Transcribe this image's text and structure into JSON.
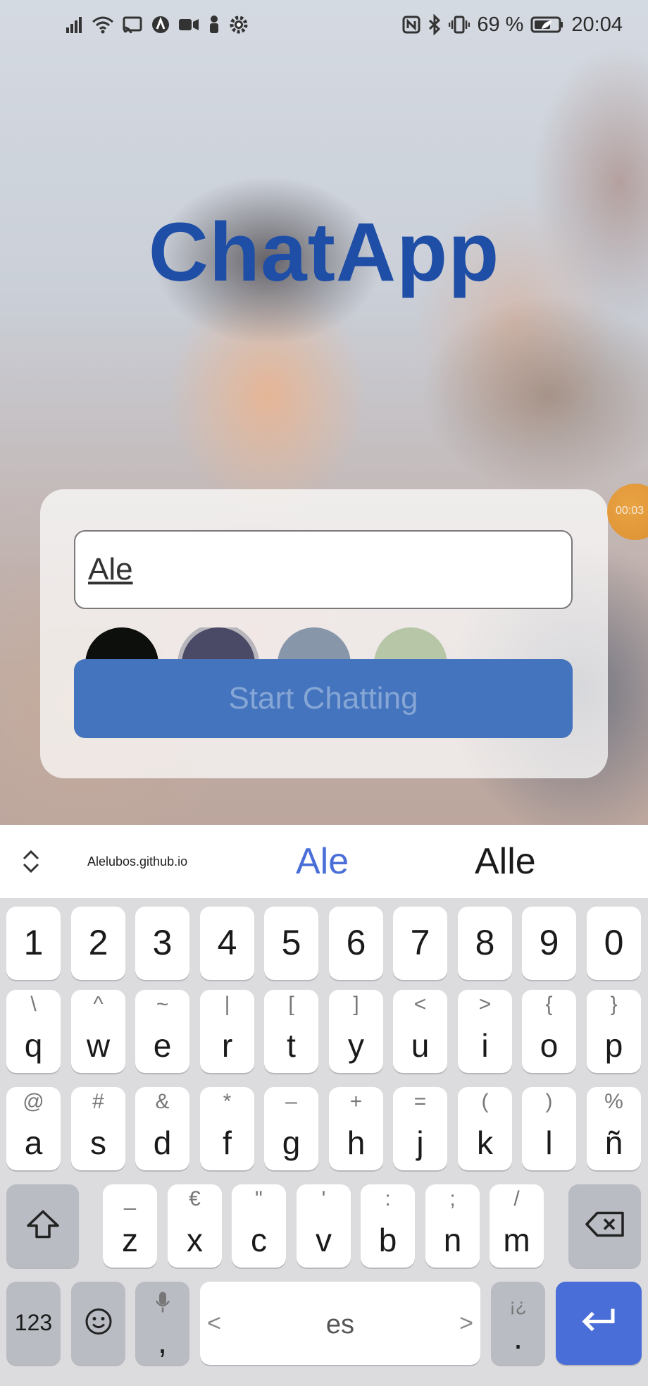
{
  "status_bar": {
    "battery_text": "69 %",
    "time": "20:04",
    "left_icons": [
      "signal-icon",
      "wifi-icon",
      "cast-icon",
      "android-auto-icon",
      "video-camera-icon",
      "person-icon",
      "settings-gear-icon"
    ],
    "right_icons": [
      "nfc-icon",
      "bluetooth-icon",
      "vibrate-icon",
      "battery-saver-icon"
    ]
  },
  "app": {
    "title": "ChatApp",
    "title_color": "#1f4ea6",
    "name_input_value": "Ale",
    "start_button_label": "Start Chatting",
    "button_color": "#4474bd",
    "color_options": [
      "#0d0f0c",
      "#4a4a66",
      "#8896aa",
      "#b6c6a6"
    ],
    "selected_color_index": 1
  },
  "overlay": {
    "timer_text": "00:03"
  },
  "keyboard": {
    "suggestions": {
      "small": "Alelubos.github.io",
      "primary": "Ale",
      "secondary": "Alle"
    },
    "number_row": [
      "1",
      "2",
      "3",
      "4",
      "5",
      "6",
      "7",
      "8",
      "9",
      "0"
    ],
    "row1": [
      {
        "main": "q",
        "sec": "\\"
      },
      {
        "main": "w",
        "sec": "^"
      },
      {
        "main": "e",
        "sec": "~"
      },
      {
        "main": "r",
        "sec": "|"
      },
      {
        "main": "t",
        "sec": "["
      },
      {
        "main": "y",
        "sec": "]"
      },
      {
        "main": "u",
        "sec": "<"
      },
      {
        "main": "i",
        "sec": ">"
      },
      {
        "main": "o",
        "sec": "{"
      },
      {
        "main": "p",
        "sec": "}"
      }
    ],
    "row2": [
      {
        "main": "a",
        "sec": "@"
      },
      {
        "main": "s",
        "sec": "#"
      },
      {
        "main": "d",
        "sec": "&"
      },
      {
        "main": "f",
        "sec": "*"
      },
      {
        "main": "g",
        "sec": "–"
      },
      {
        "main": "h",
        "sec": "+"
      },
      {
        "main": "j",
        "sec": "="
      },
      {
        "main": "k",
        "sec": "("
      },
      {
        "main": "l",
        "sec": ")"
      },
      {
        "main": "ñ",
        "sec": "%"
      }
    ],
    "row3": [
      {
        "main": "z",
        "sec": "_"
      },
      {
        "main": "x",
        "sec": "€"
      },
      {
        "main": "c",
        "sec": "\""
      },
      {
        "main": "v",
        "sec": "'"
      },
      {
        "main": "b",
        "sec": ":"
      },
      {
        "main": "n",
        "sec": ";"
      },
      {
        "main": "m",
        "sec": "/"
      }
    ],
    "bottom": {
      "numbers_label": "123",
      "comma": ",",
      "space_label": "es",
      "left_arrow": "<",
      "right_arrow": ">",
      "period": ".",
      "period_sec": "¡¿"
    },
    "enter_color": "#4a6ed8"
  }
}
